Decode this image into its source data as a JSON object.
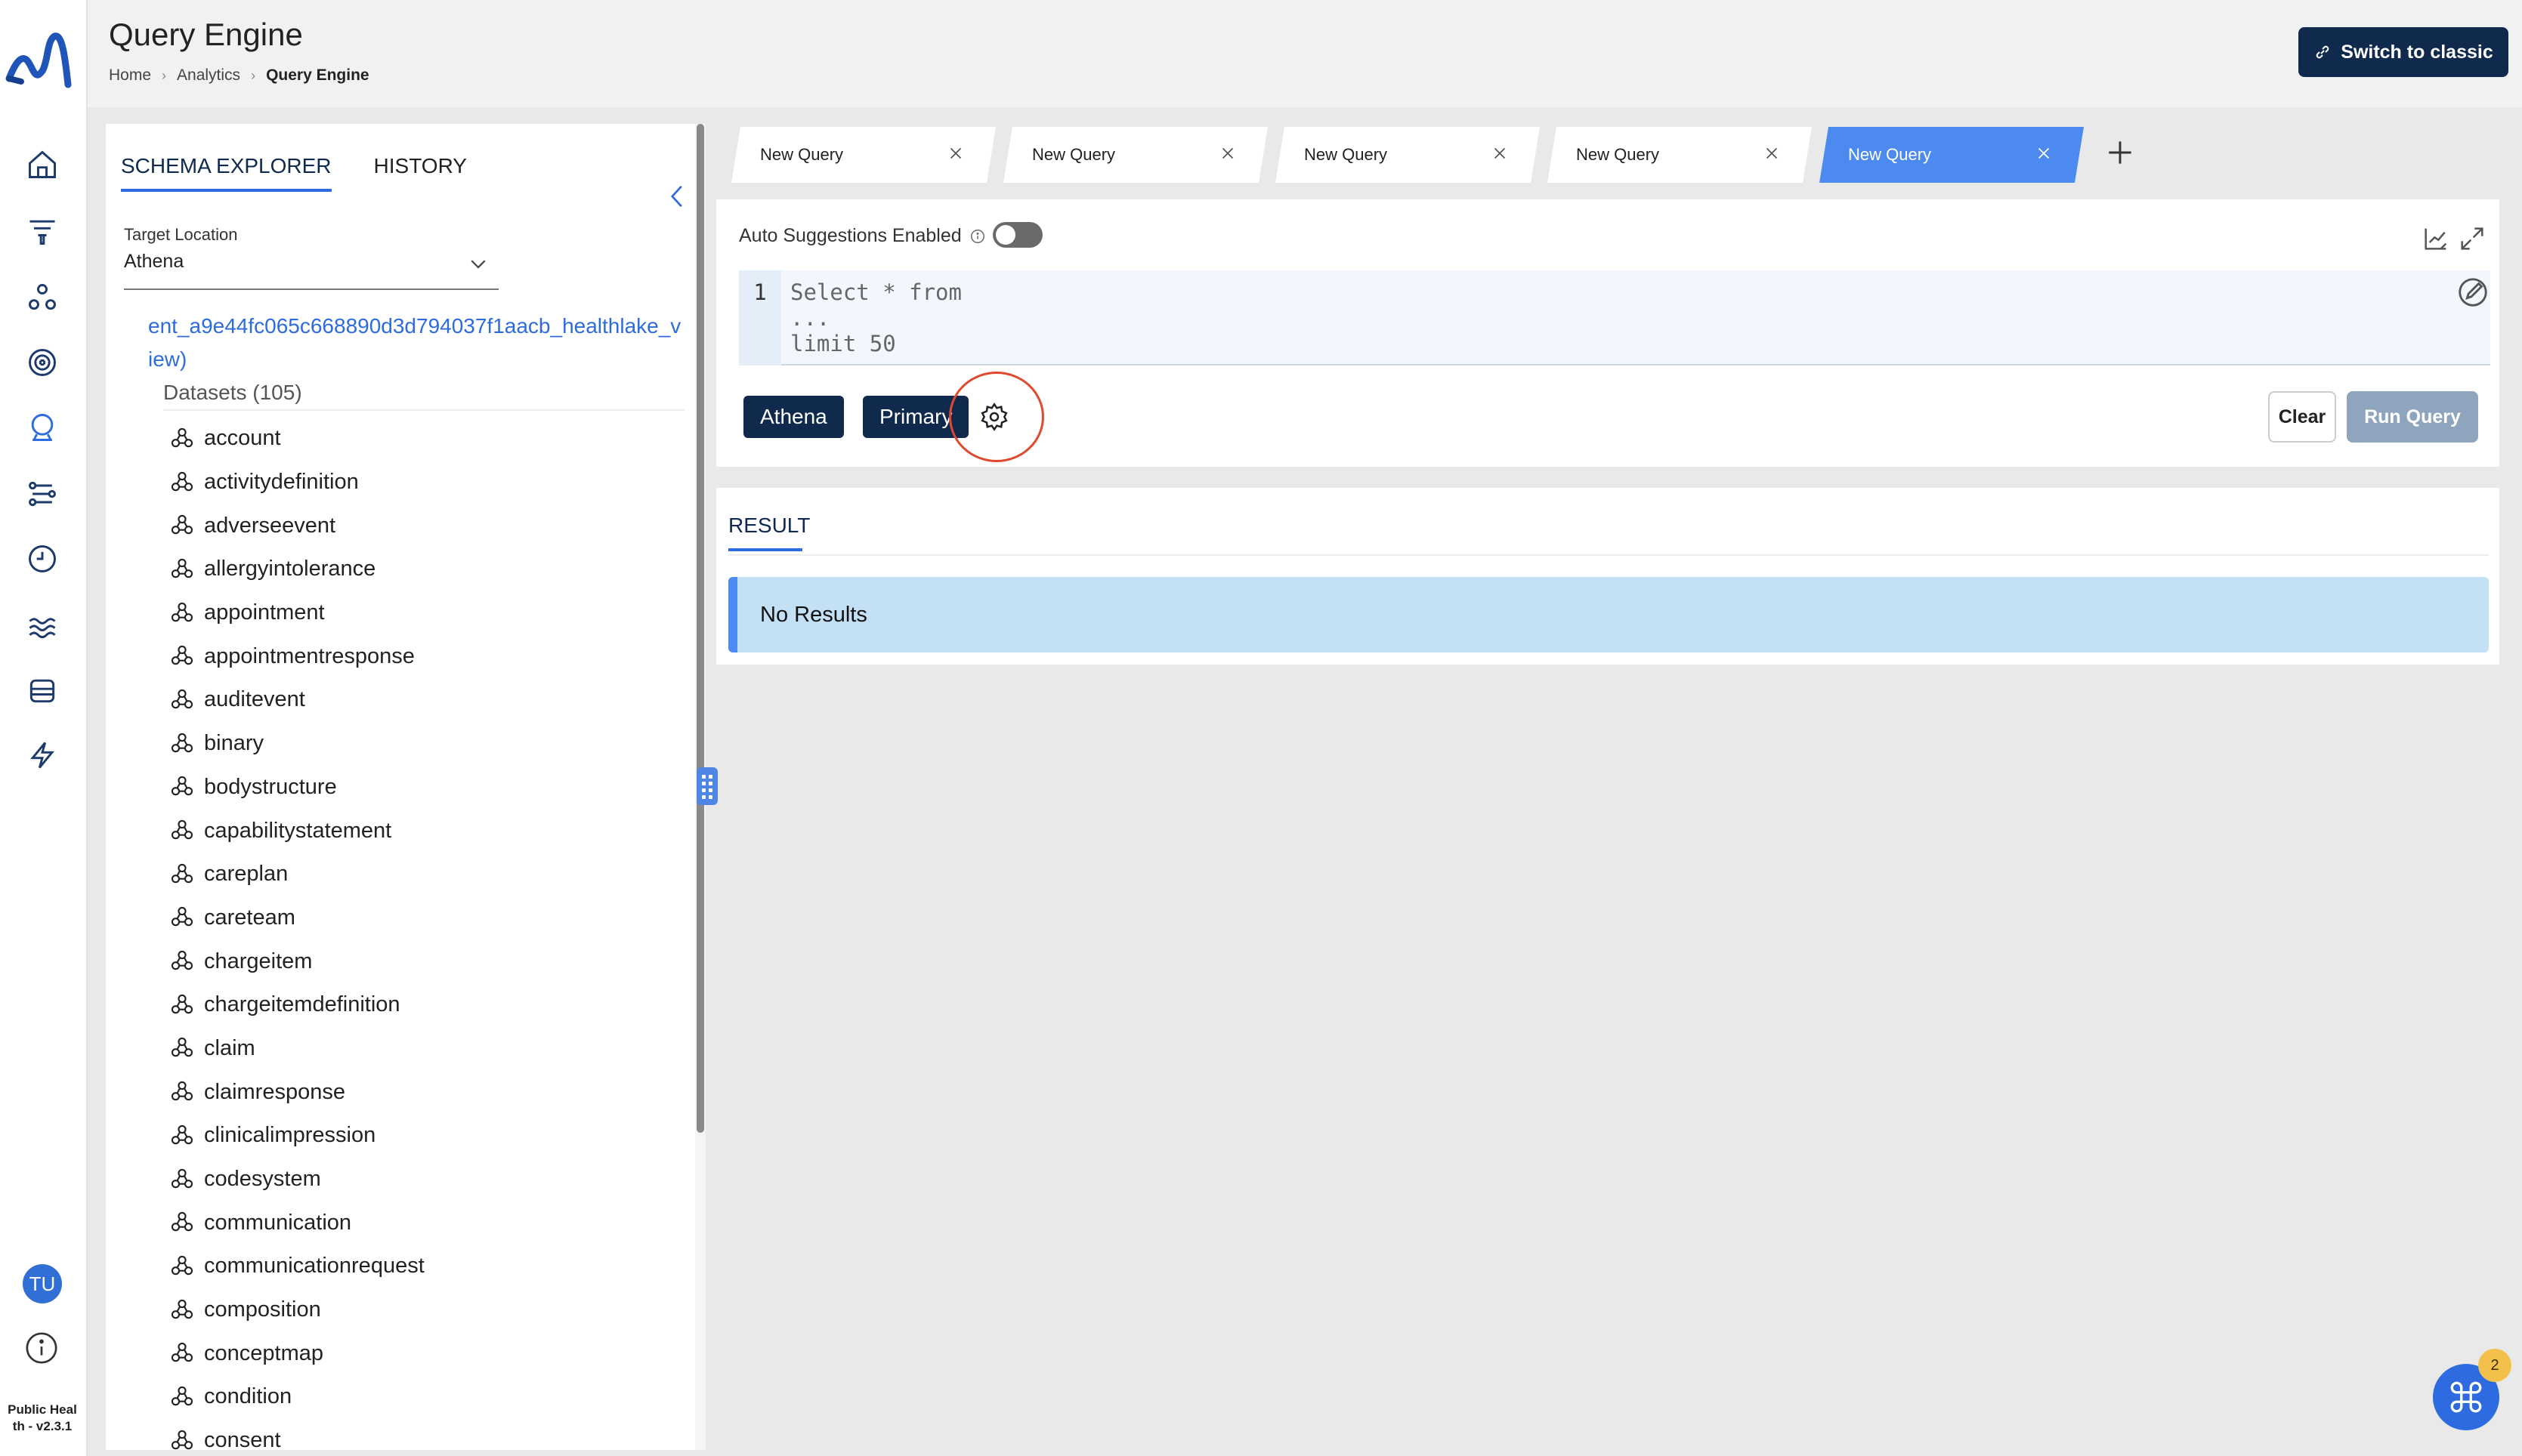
{
  "header": {
    "title": "Query Engine",
    "breadcrumb": [
      "Home",
      "Analytics",
      "Query Engine"
    ],
    "switch_label": "Switch to classic"
  },
  "rail": {
    "items": [
      {
        "icon": "home-icon"
      },
      {
        "icon": "funnel-icon"
      },
      {
        "icon": "network-icon"
      },
      {
        "icon": "target-icon"
      },
      {
        "icon": "query-icon",
        "active": true
      },
      {
        "icon": "workflow-icon"
      },
      {
        "icon": "clock-icon"
      },
      {
        "icon": "waves-icon"
      },
      {
        "icon": "database-icon"
      },
      {
        "icon": "bolt-icon"
      }
    ],
    "avatar_initials": "TU",
    "version_text": "Public Heal th - v2.3.1"
  },
  "explorer": {
    "tabs": [
      "SCHEMA EXPLORER",
      "HISTORY"
    ],
    "target_location_label": "Target Location",
    "target_location_value": "Athena",
    "database_name": "ent_a9e44fc065c668890d3d794037f1aacb_healthlake_view)",
    "datasets_label": "Datasets (105)",
    "datasets": [
      "account",
      "activitydefinition",
      "adverseevent",
      "allergyintolerance",
      "appointment",
      "appointmentresponse",
      "auditevent",
      "binary",
      "bodystructure",
      "capabilitystatement",
      "careplan",
      "careteam",
      "chargeitem",
      "chargeitemdefinition",
      "claim",
      "claimresponse",
      "clinicalimpression",
      "codesystem",
      "communication",
      "communicationrequest",
      "composition",
      "conceptmap",
      "condition",
      "consent"
    ]
  },
  "query_tabs": [
    {
      "label": "New Query"
    },
    {
      "label": "New Query"
    },
    {
      "label": "New Query"
    },
    {
      "label": "New Query"
    },
    {
      "label": "New Query",
      "active": true
    }
  ],
  "editor": {
    "auto_suggestions_label": "Auto Suggestions Enabled",
    "auto_suggestions_on": false,
    "line_number": "1",
    "code_lines": [
      "Select * from",
      "...",
      "limit 50"
    ],
    "engine_chip": "Athena",
    "workgroup_chip": "Primary",
    "clear_label": "Clear",
    "run_label": "Run Query"
  },
  "result": {
    "tab_label": "RESULT",
    "message": "No Results"
  },
  "fab": {
    "badge_count": "2"
  },
  "colors": {
    "navy": "#0f2a4d",
    "accent": "#2e6be0",
    "active_tab": "#4d8aef",
    "info_bg": "#c4e0f4",
    "highlight": "#e04a2f"
  }
}
